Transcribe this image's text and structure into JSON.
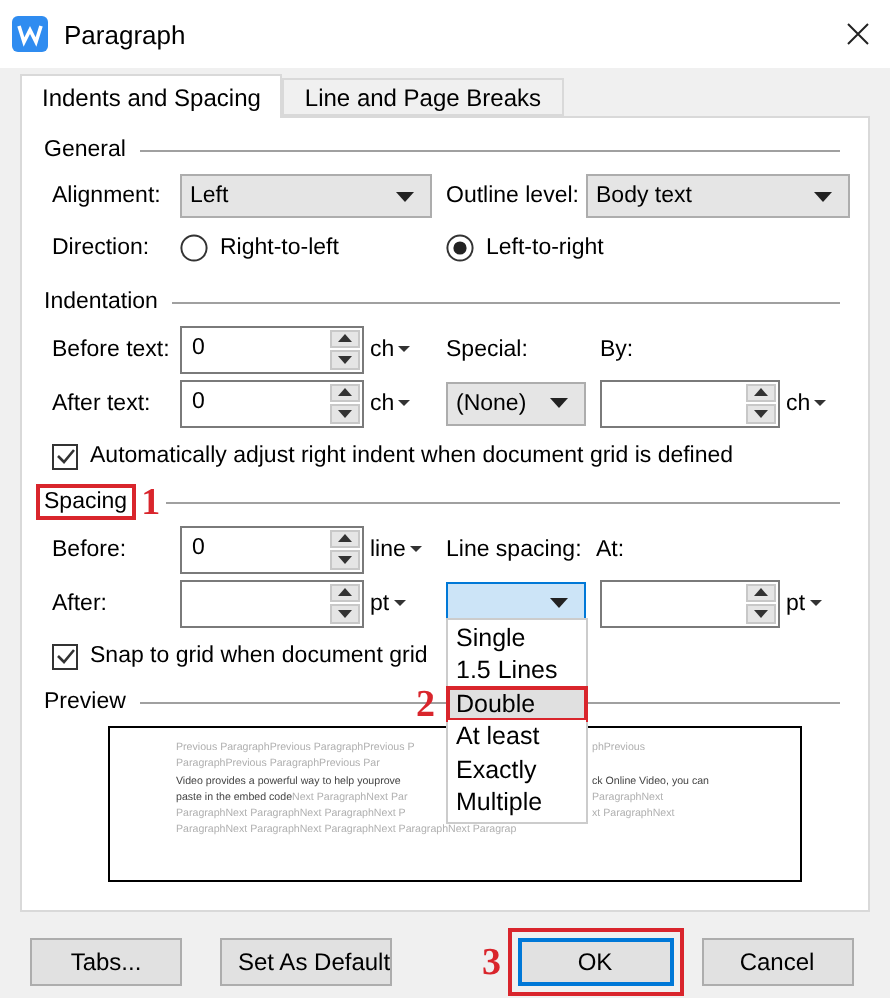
{
  "window": {
    "title": "Paragraph"
  },
  "tabs": [
    {
      "label": "Indents and Spacing",
      "selected": true
    },
    {
      "label": "Line and Page Breaks",
      "selected": false
    }
  ],
  "general": {
    "title": "General",
    "alignment": {
      "label": "Alignment:",
      "value": "Left"
    },
    "outline_level": {
      "label": "Outline level:",
      "value": "Body text"
    },
    "direction": {
      "label": "Direction:",
      "options": [
        {
          "label": "Right-to-left",
          "selected": false
        },
        {
          "label": "Left-to-right",
          "selected": true
        }
      ]
    }
  },
  "indentation": {
    "title": "Indentation",
    "before_text": {
      "label": "Before text:",
      "value": "0",
      "unit": "ch"
    },
    "after_text": {
      "label": "After text:",
      "value": "0",
      "unit": "ch"
    },
    "special": {
      "label": "Special:",
      "value": "(None)"
    },
    "by": {
      "label": "By:",
      "unit": "ch"
    },
    "auto_adjust": {
      "label": "Automatically adjust right indent when document grid is defined",
      "checked": true
    }
  },
  "spacing": {
    "title": "Spacing",
    "highlighted": true,
    "marker": "1",
    "before": {
      "label": "Before:",
      "value": "0",
      "unit": "line"
    },
    "after": {
      "label": "After:",
      "unit": "pt"
    },
    "line_spacing": {
      "label": "Line spacing:",
      "expanded": true,
      "options": [
        {
          "label": "Single",
          "selected": false,
          "highlighted": false
        },
        {
          "label": "1.5 Lines",
          "selected": false,
          "highlighted": false
        },
        {
          "label": "Double",
          "selected": true,
          "highlighted": true,
          "marker": "2"
        },
        {
          "label": "At least",
          "selected": false,
          "highlighted": false
        },
        {
          "label": "Exactly",
          "selected": false,
          "highlighted": false
        },
        {
          "label": "Multiple",
          "selected": false,
          "highlighted": false
        }
      ]
    },
    "at": {
      "label": "At:",
      "unit": "pt"
    },
    "snap": {
      "label": "Snap to grid when document grid",
      "checked": true
    }
  },
  "preview": {
    "title": "Preview",
    "lines": [
      {
        "left": [
          {
            "kind": "previous",
            "text": "Previous ParagraphPrevious ParagraphPrevious P"
          }
        ],
        "right": [
          {
            "kind": "previous",
            "text": "phPrevious"
          }
        ]
      },
      {
        "left": [
          {
            "kind": "previous",
            "text": "ParagraphPrevious ParagraphPrevious Par"
          }
        ]
      },
      {
        "left": [
          {
            "kind": "current",
            "text": "Video provides a powerful way to help youprove"
          }
        ],
        "right": [
          {
            "kind": "current",
            "text": "ck Online Video, you can"
          }
        ]
      },
      {
        "left": [
          {
            "kind": "current",
            "text": "paste in the embed code"
          },
          {
            "kind": "next",
            "text": "Next ParagraphNext Par"
          }
        ],
        "right": [
          {
            "kind": "next",
            "text": "ParagraphNext"
          }
        ]
      },
      {
        "left": [
          {
            "kind": "next",
            "text": "ParagraphNext ParagraphNext ParagraphNext P"
          }
        ],
        "right": [
          {
            "kind": "next",
            "text": "xt ParagraphNext"
          }
        ]
      },
      {
        "left": [
          {
            "kind": "next",
            "text": "ParagraphNext ParagraphNext ParagraphNext ParagraphNext Paragrap"
          }
        ]
      }
    ]
  },
  "buttons": [
    {
      "label": "Tabs...",
      "default": false,
      "highlighted": false
    },
    {
      "label": "Set As Default",
      "default": false,
      "highlighted": false
    },
    {
      "label": "OK",
      "default": true,
      "highlighted": true,
      "marker": "3"
    },
    {
      "label": "Cancel",
      "default": false,
      "highlighted": false
    }
  ]
}
